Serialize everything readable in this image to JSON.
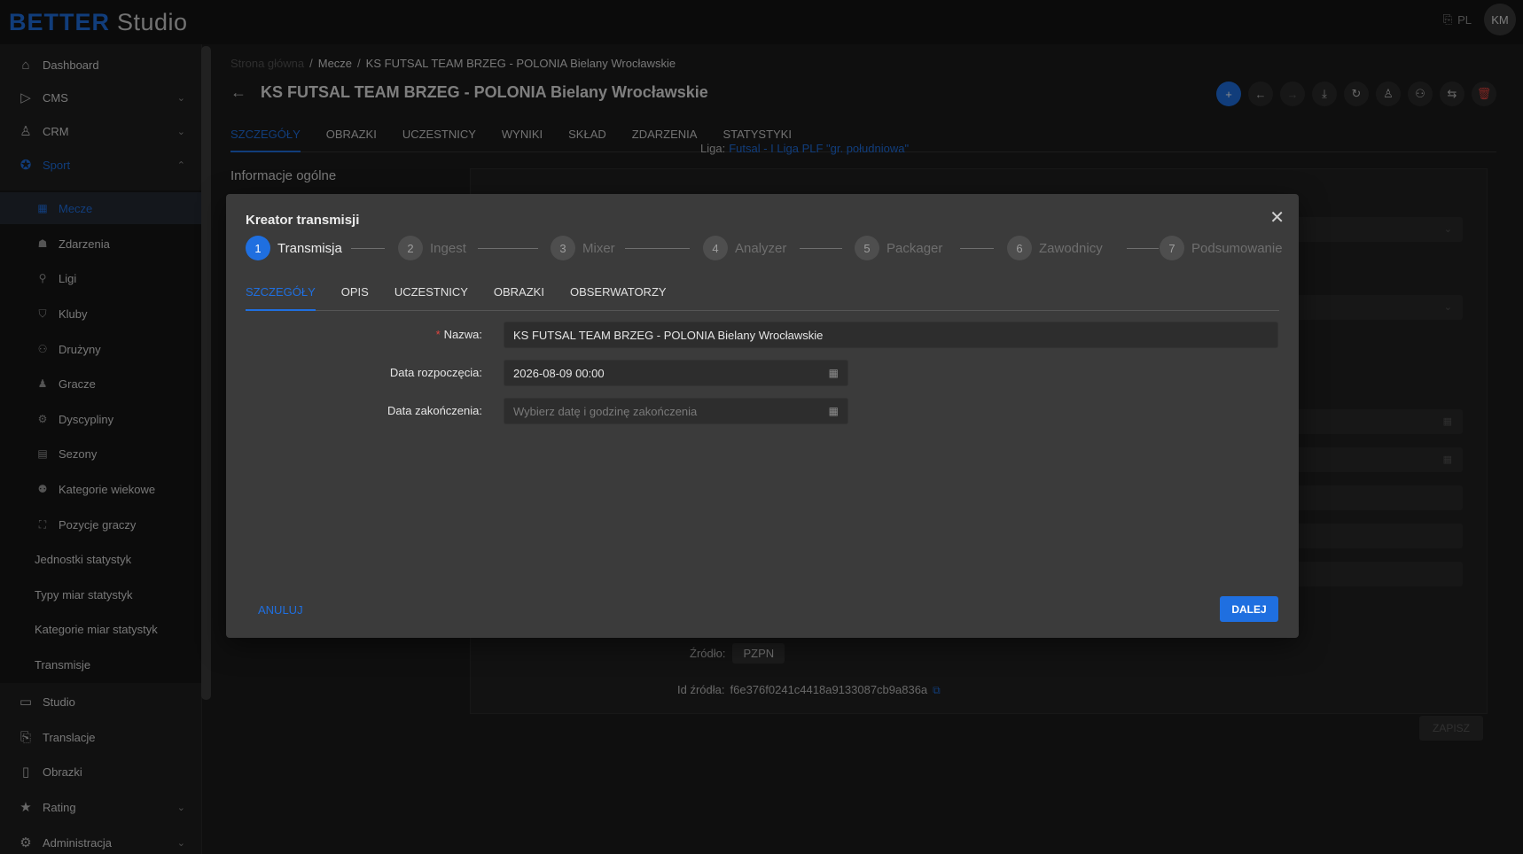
{
  "app": {
    "brand_bold": "BETTER",
    "brand_light": "Studio",
    "lang": "PL",
    "user_initials": "KM"
  },
  "sidebar": {
    "items": [
      {
        "label": "Dashboard",
        "icon": "home-icon"
      },
      {
        "label": "CMS",
        "icon": "play-icon"
      },
      {
        "label": "CRM",
        "icon": "person-icon"
      },
      {
        "label": "Sport",
        "icon": "medal-icon"
      }
    ],
    "sport_items": [
      {
        "label": "Mecze",
        "icon": "grid-icon"
      },
      {
        "label": "Zdarzenia",
        "icon": "event-icon"
      },
      {
        "label": "Ligi",
        "icon": "tree-icon"
      },
      {
        "label": "Kluby",
        "icon": "club-icon"
      },
      {
        "label": "Drużyny",
        "icon": "team-icon"
      },
      {
        "label": "Gracze",
        "icon": "player-icon"
      },
      {
        "label": "Dyscypliny",
        "icon": "discipline-icon"
      },
      {
        "label": "Sezony",
        "icon": "season-icon"
      },
      {
        "label": "Kategorie wiekowe",
        "icon": "age-icon"
      },
      {
        "label": "Pozycje graczy",
        "icon": "position-icon"
      },
      {
        "label": "Jednostki statystyk"
      },
      {
        "label": "Typy miar statystyk"
      },
      {
        "label": "Kategorie miar statystyk"
      },
      {
        "label": "Transmisje"
      }
    ],
    "bottom_items": [
      {
        "label": "Studio",
        "icon": "studio-icon"
      },
      {
        "label": "Translacje",
        "icon": "translate-icon"
      },
      {
        "label": "Obrazki",
        "icon": "image-icon"
      },
      {
        "label": "Rating",
        "icon": "star-icon"
      },
      {
        "label": "Administracja",
        "icon": "gear-icon"
      }
    ]
  },
  "breadcrumb": {
    "home": "Strona główna",
    "section": "Mecze",
    "current": "KS FUTSAL TEAM BRZEG - POLONIA Bielany Wrocławskie"
  },
  "page": {
    "title": "KS FUTSAL TEAM BRZEG - POLONIA Bielany Wrocławskie",
    "tabs": [
      "SZCZEGÓŁY",
      "OBRAZKI",
      "UCZESTNICY",
      "WYNIKI",
      "SKŁAD",
      "ZDARZENIA",
      "STATYSTYKI"
    ],
    "section_title": "Informacje ogólne",
    "liga_label": "Liga",
    "liga_value": "Futsal - I Liga PLF \"gr. południowa\"",
    "zrodlo_label": "Źródło",
    "zrodlo_value": "PZPN",
    "id_zrodla_label": "Id źródła",
    "id_zrodla_value": "f6e376f0241c4418a9133087cb9a836a",
    "save_label": "ZAPISZ"
  },
  "modal": {
    "title": "Kreator transmisji",
    "steps": [
      {
        "num": "1",
        "label": "Transmisja"
      },
      {
        "num": "2",
        "label": "Ingest"
      },
      {
        "num": "3",
        "label": "Mixer"
      },
      {
        "num": "4",
        "label": "Analyzer"
      },
      {
        "num": "5",
        "label": "Packager"
      },
      {
        "num": "6",
        "label": "Zawodnicy"
      },
      {
        "num": "7",
        "label": "Podsumowanie"
      }
    ],
    "tabs": [
      "SZCZEGÓŁY",
      "OPIS",
      "UCZESTNICY",
      "OBRAZKI",
      "OBSERWATORZY"
    ],
    "fields": {
      "name_label": "Nazwa",
      "name_value": "KS FUTSAL TEAM BRZEG - POLONIA Bielany Wrocławskie",
      "start_label": "Data rozpoczęcia",
      "start_value": "2026-08-09 00:00",
      "end_label": "Data zakończenia",
      "end_placeholder": "Wybierz datę i godzinę zakończenia"
    },
    "cancel_label": "ANULUJ",
    "next_label": "DALEJ"
  }
}
